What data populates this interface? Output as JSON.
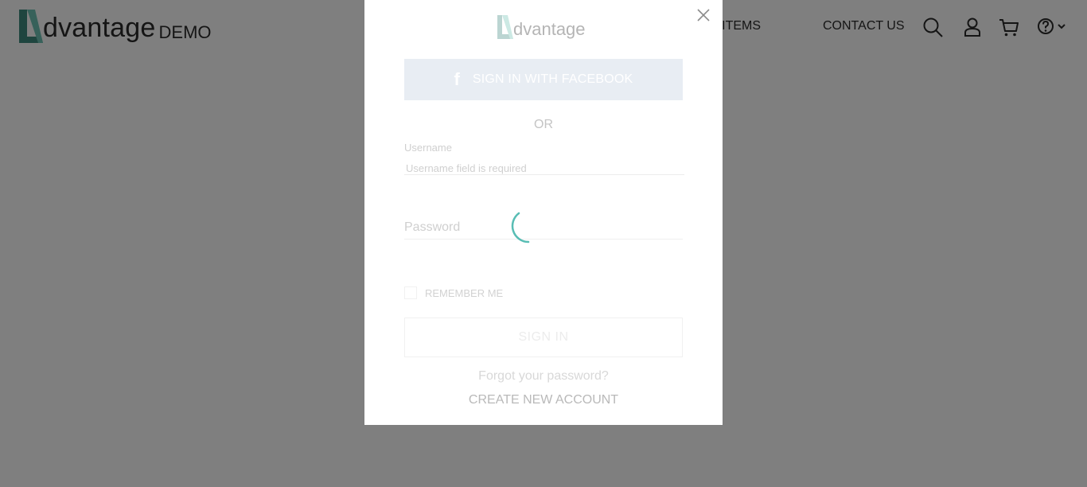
{
  "header": {
    "brand_word": "dvantage",
    "brand_suffix": "DEMO",
    "nav": {
      "popular_items": "ULAR ITEMS",
      "contact_us": "CONTACT US"
    },
    "icons": [
      "search-icon",
      "user-icon",
      "cart-icon",
      "help-icon",
      "chevron-down-icon"
    ]
  },
  "login_modal": {
    "logo_word": "dvantage",
    "facebook_button": "SIGN IN WITH FACEBOOK",
    "or_separator": "OR",
    "username_label": "Username",
    "username_error": "Username field is required",
    "password_placeholder": "Password",
    "remember_me": "REMEMBER ME",
    "sign_in_button": "SIGN IN",
    "forgot_password": "Forgot your password?",
    "create_account": "CREATE NEW ACCOUNT",
    "loading": true
  },
  "colors": {
    "accent": "#3bb1a7",
    "brand_mark": "#3f8a7f",
    "overlay": "rgba(0,0,0,0.5)"
  }
}
